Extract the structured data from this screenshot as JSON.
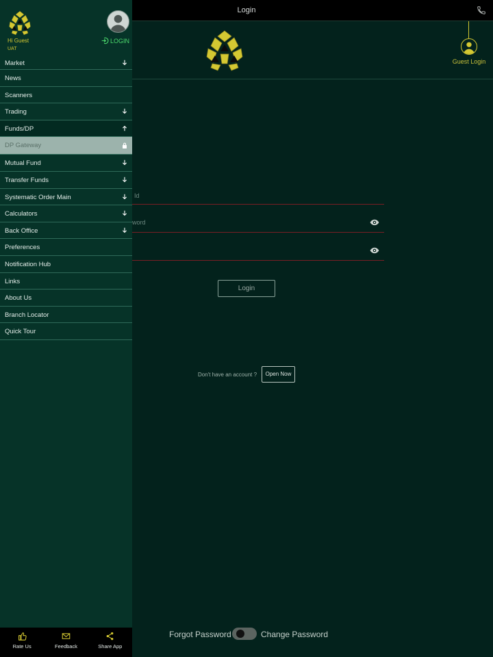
{
  "topbar": {
    "title": "Login",
    "phone_icon": "phone-icon"
  },
  "guest": {
    "label": "Guest Login"
  },
  "form": {
    "user_id_placeholder": "Id",
    "password_placeholder": "word",
    "login_label": "Login",
    "no_account_text": "Don't have an account ?",
    "open_now_label": "Open Now",
    "forgot_password": "Forgot Password",
    "change_password": "Change Password"
  },
  "drawer": {
    "greeting": "Hi Guest",
    "env": "UAT",
    "login_label": "LOGIN",
    "items": [
      {
        "label": "Market",
        "arrow": "down"
      },
      {
        "label": "News",
        "arrow": ""
      },
      {
        "label": "Scanners",
        "arrow": ""
      },
      {
        "label": "Trading",
        "arrow": "down"
      },
      {
        "label": "Funds/DP",
        "arrow": "up"
      },
      {
        "label": "DP Gateway",
        "arrow": "lock"
      },
      {
        "label": "Mutual Fund",
        "arrow": "down"
      },
      {
        "label": "Transfer Funds",
        "arrow": "down"
      },
      {
        "label": "Systematic Order Main",
        "arrow": "down"
      },
      {
        "label": "Calculators",
        "arrow": "down"
      },
      {
        "label": "Back Office",
        "arrow": "down"
      },
      {
        "label": "Preferences",
        "arrow": ""
      },
      {
        "label": "Notification Hub",
        "arrow": ""
      },
      {
        "label": "Links",
        "arrow": ""
      },
      {
        "label": "About Us",
        "arrow": ""
      },
      {
        "label": "Branch Locator",
        "arrow": ""
      },
      {
        "label": "Quick Tour",
        "arrow": ""
      }
    ],
    "bottom": [
      {
        "label": "Rate Us",
        "icon": "thumbs-up-icon"
      },
      {
        "label": "Feedback",
        "icon": "mail-icon"
      },
      {
        "label": "Share App",
        "icon": "share-icon"
      }
    ]
  },
  "colors": {
    "background": "#03221c",
    "drawer": "#063328",
    "accent_yellow": "#d4c832",
    "login_green": "#4ddc6e",
    "error_red": "#7a1e24"
  }
}
